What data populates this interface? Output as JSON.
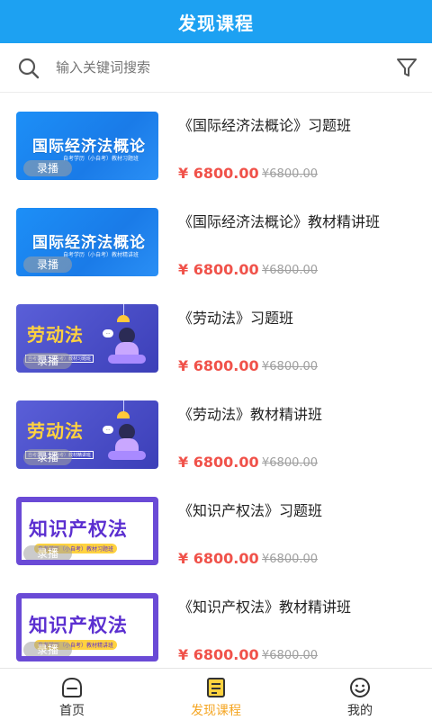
{
  "header": {
    "title": "发现课程"
  },
  "search": {
    "placeholder": "输入关键词搜索"
  },
  "courses": [
    {
      "thumb_title": "国际经济法概论",
      "thumb_sub": "自考学历（小自考）教材习题班",
      "badge": "录播",
      "title": "《国际经济法概论》习题班",
      "price": "¥ 6800.00",
      "original_price": "¥6800.00"
    },
    {
      "thumb_title": "国际经济法概论",
      "thumb_sub": "自考学历（小自考）教材精讲班",
      "badge": "录播",
      "title": "《国际经济法概论》教材精讲班",
      "price": "¥ 6800.00",
      "original_price": "¥6800.00"
    },
    {
      "thumb_title": "劳动法",
      "thumb_sub": "自考学历（小自考）教材习题班",
      "badge": "录播",
      "title": "《劳动法》习题班",
      "price": "¥ 6800.00",
      "original_price": "¥6800.00"
    },
    {
      "thumb_title": "劳动法",
      "thumb_sub": "自考学历（小自考）教材精讲班",
      "badge": "录播",
      "title": "《劳动法》教材精讲班",
      "price": "¥ 6800.00",
      "original_price": "¥6800.00"
    },
    {
      "thumb_title": "知识产权法",
      "thumb_sub": "自考学历（小自考）教材习题班",
      "badge": "录播",
      "title": "《知识产权法》习题班",
      "price": "¥ 6800.00",
      "original_price": "¥6800.00"
    },
    {
      "thumb_title": "知识产权法",
      "thumb_sub": "自考学历（小自考）教材精讲班",
      "badge": "录播",
      "title": "《知识产权法》教材精讲班",
      "price": "¥ 6800.00",
      "original_price": "¥6800.00"
    }
  ],
  "tabbar": {
    "items": [
      {
        "label": "首页",
        "icon": "home-icon",
        "active": false
      },
      {
        "label": "发现课程",
        "icon": "discover-icon",
        "active": true
      },
      {
        "label": "我的",
        "icon": "profile-icon",
        "active": false
      }
    ]
  },
  "colors": {
    "brand": "#1da1f2",
    "price": "#f0524a",
    "active_tab": "#f5a623"
  }
}
